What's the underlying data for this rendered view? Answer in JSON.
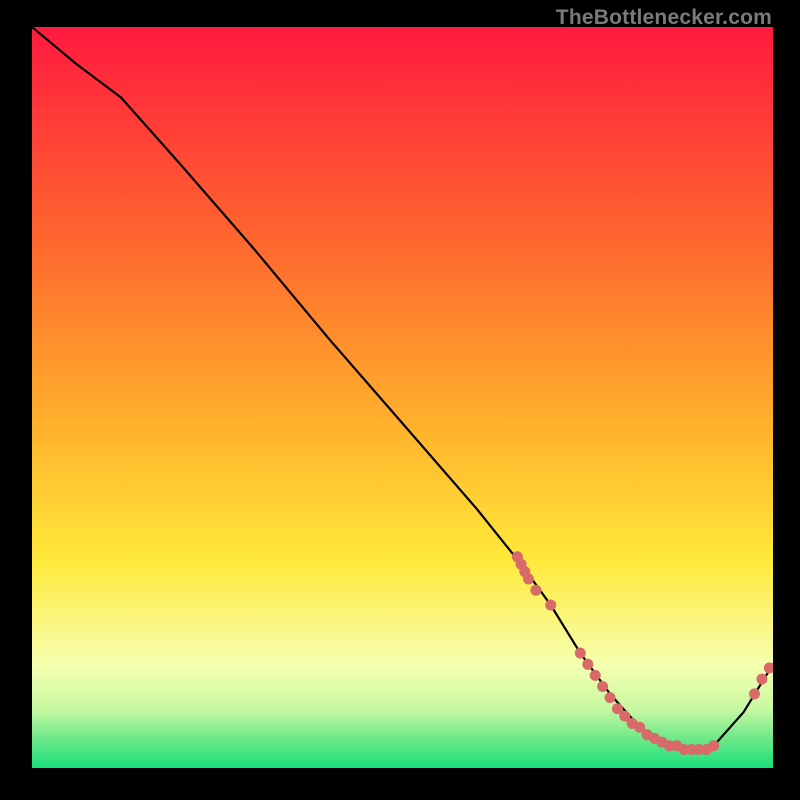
{
  "watermark": "TheBottlenecker.com",
  "colors": {
    "bg_black": "#000000",
    "curve_stroke": "#000000",
    "point_fill": "#d86a6a",
    "text_gray": "#777b7d",
    "grad_red": "#ff1a3f",
    "grad_orange": "#ff9a2e",
    "grad_yellow": "#ffe93a",
    "grad_pale": "#f6ffb0",
    "grad_green_light": "#6fe889",
    "grad_green": "#17e07a"
  },
  "chart_data": {
    "type": "line",
    "title": "",
    "xlabel": "",
    "ylabel": "",
    "xlim": [
      0,
      100
    ],
    "ylim": [
      0,
      100
    ],
    "x": [
      0,
      6,
      12,
      20,
      30,
      40,
      50,
      60,
      66,
      70,
      74,
      78,
      82,
      86,
      90,
      92,
      96,
      100
    ],
    "y": [
      100,
      95,
      90.5,
      81.5,
      70,
      58,
      46.5,
      35,
      27.5,
      22,
      15.5,
      10,
      5.5,
      3,
      2.5,
      3,
      7.5,
      14
    ],
    "points_x": [
      65.5,
      66,
      66.5,
      67,
      68,
      70,
      74,
      75,
      76,
      77,
      78,
      79,
      80,
      81,
      82,
      83,
      84,
      85,
      86,
      87,
      88,
      89,
      90,
      91,
      92,
      97.5,
      98.5,
      99.5
    ],
    "points_y": [
      28.5,
      27.5,
      26.5,
      25.5,
      24,
      22,
      15.5,
      14,
      12.5,
      11,
      9.5,
      8,
      7,
      6,
      5.5,
      4.5,
      4,
      3.5,
      3,
      3,
      2.5,
      2.5,
      2.5,
      2.5,
      3,
      10,
      12,
      13.5
    ],
    "gradient_stops": [
      {
        "pos": 0.0,
        "color": "#ff1a3f"
      },
      {
        "pos": 0.3,
        "color": "#ff6a2e"
      },
      {
        "pos": 0.55,
        "color": "#ffb52c"
      },
      {
        "pos": 0.72,
        "color": "#ffe93a"
      },
      {
        "pos": 0.86,
        "color": "#f6ffb0"
      },
      {
        "pos": 0.92,
        "color": "#c7f9a2"
      },
      {
        "pos": 0.96,
        "color": "#6fe889"
      },
      {
        "pos": 1.0,
        "color": "#17e07a"
      }
    ]
  }
}
